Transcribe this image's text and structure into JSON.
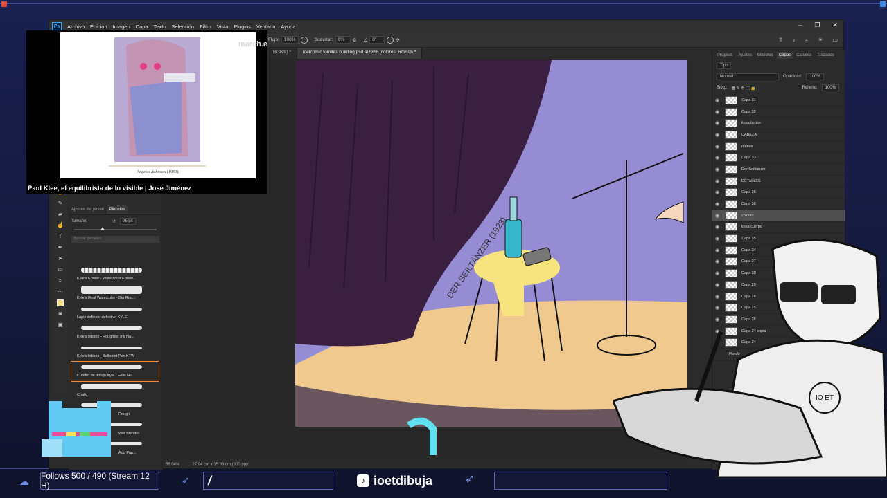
{
  "app": {
    "name": "Photoshop",
    "logo": "Ps",
    "menu": [
      "Archivo",
      "Edición",
      "Imagen",
      "Capa",
      "Texto",
      "Selección",
      "Filtro",
      "Vista",
      "Plugins",
      "Ventana",
      "Ayuda"
    ]
  },
  "options_bar": {
    "flujo_label": "Flujo:",
    "flujo_value": "100%",
    "suavizar_label": "Suavizar:",
    "suavizar_value": "0%",
    "angle_value": "0°"
  },
  "document_tabs": [
    {
      "label": "RGB/8) *"
    },
    {
      "label": "ioetcomic fornites building.psd al 58% (colores, RGB/8) *",
      "active": true
    }
  ],
  "brush_panel": {
    "tabs": [
      "Ajustes del pincel",
      "Pinceles"
    ],
    "size_label": "Tamaño:",
    "size_value": "95 px",
    "search_placeholder": "Buscar pinceles",
    "brushes": [
      {
        "label": "Kyle's Eraser - Watercolor Eraser..."
      },
      {
        "label": "Kyle's Real Watercolor - Big Rou..."
      },
      {
        "label": "Lápiz definido definitivo KYLE"
      },
      {
        "label": "Kyle's Inkbox - Roughest Ink Na..."
      },
      {
        "label": "Kyle's Inkbox - Ballpoint Pen KTW"
      },
      {
        "label": "Cuadro de dibujo Kyle - Felix Hil",
        "selected": true
      },
      {
        "label": "Chalk"
      },
      {
        "label": "Rough"
      },
      {
        "label": "Wet Blender"
      },
      {
        "label": "Add Pap..."
      }
    ]
  },
  "canvas": {
    "text_on_drawing": "DER SEILTÄNZER (1923)",
    "zoom": "58.04%",
    "doc_size": "27.94 cm x 15.39 cm (300 ppp)"
  },
  "layers_panel": {
    "tabs": [
      "Propied.",
      "Ajustes",
      "Bibliotec",
      "Capas",
      "Canales",
      "Trazados"
    ],
    "active_tab": "Capas",
    "filter": "Tipo",
    "blend_mode": "Normal",
    "opacity_label": "Opacidad:",
    "opacity_value": "100%",
    "lock_label": "Bloq.:",
    "fill_label": "Relleno:",
    "fill_value": "100%",
    "layers": [
      "Capa 31",
      "Capa 32",
      "linea lentes",
      "CABEZA",
      "manos",
      "Capa 33",
      "Der Seiltanzer",
      "DETALLES",
      "Capa 36",
      "Capa 38",
      "colores",
      "linea cuerpo",
      "Capa 35",
      "Capa 34",
      "Capa 27",
      "Capa 30",
      "Capa 29",
      "Capa 28",
      "Capa 25",
      "Capa 26",
      "Capa 24 copia",
      "Capa 24",
      "Fondo"
    ],
    "selected": "colores"
  },
  "video_overlay": {
    "caption": "Paul Klee, el equilibrista de lo visible | Jose Jiménez",
    "slide_caption_title": "Angelus dubiosus",
    "slide_caption_year": "(1939).",
    "watermark": "march.e"
  },
  "stream_overlay": {
    "follows": "Follows 500 / 490 (Stream 12 H)",
    "command": "/",
    "handle": "ioetdibuja"
  },
  "colors": {
    "frame_accent": "#6b78c8",
    "canvas_bg": "#9a92d6",
    "curtain": "#3b1f40",
    "floor_light": "#f1c98f",
    "bottle": "#38b6c9",
    "stool_highlight": "#f7e47e"
  }
}
